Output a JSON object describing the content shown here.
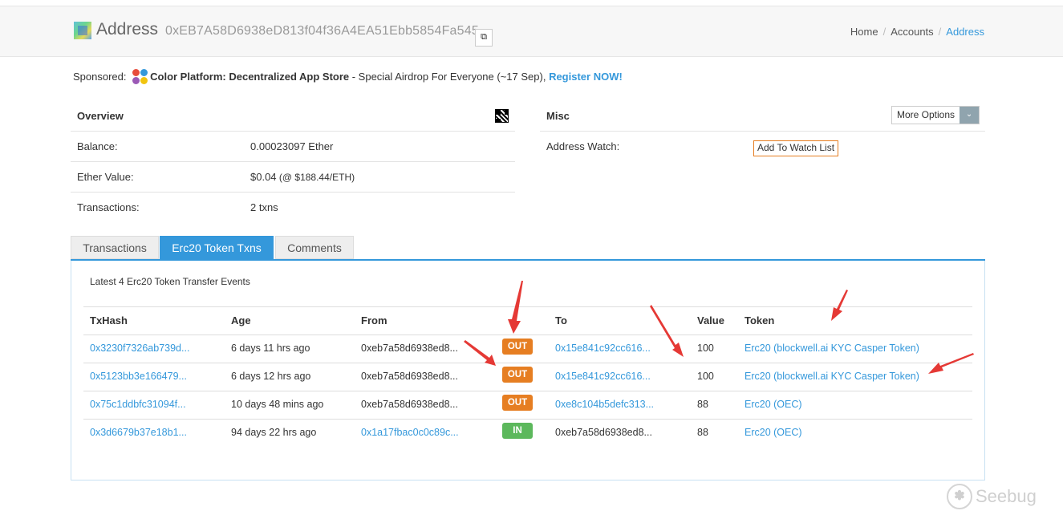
{
  "header": {
    "title": "Address",
    "address": "0xEB7A58D6938eD813f04f36A4EA51Ebb5854Fa545",
    "breadcrumb": [
      "Home",
      "Accounts",
      "Address"
    ]
  },
  "sponsored": {
    "label": "Sponsored:",
    "name": "Color Platform: Decentralized App Store",
    "text": " - Special Airdrop For Everyone (~17 Sep), ",
    "cta": "Register NOW!"
  },
  "overview": {
    "title": "Overview",
    "rows": [
      {
        "label": "Balance:",
        "value": "0.00023097 Ether"
      },
      {
        "label": "Ether Value:",
        "value": "$0.04",
        "extra": " (@ $188.44/ETH)"
      },
      {
        "label": "Transactions:",
        "value": "2 txns"
      }
    ]
  },
  "misc": {
    "title": "Misc",
    "more_options": "More Options",
    "watch_label": "Address Watch:",
    "watch_button": "Add To Watch List"
  },
  "tabs": [
    "Transactions",
    "Erc20 Token Txns",
    "Comments"
  ],
  "active_tab": 1,
  "token_txns": {
    "caption": "Latest 4 Erc20 Token Transfer Events",
    "columns": [
      "TxHash",
      "Age",
      "From",
      "",
      "To",
      "Value",
      "Token"
    ],
    "rows": [
      {
        "hash": "0x3230f7326ab739d...",
        "age": "6 days 11 hrs ago",
        "from": "0xeb7a58d6938ed8...",
        "dir": "OUT",
        "to": "0x15e841c92cc616...",
        "value": "100",
        "token": "Erc20 (blockwell.ai KYC Casper Token)"
      },
      {
        "hash": "0x5123bb3e166479...",
        "age": "6 days 12 hrs ago",
        "from": "0xeb7a58d6938ed8...",
        "dir": "OUT",
        "to": "0x15e841c92cc616...",
        "value": "100",
        "token": "Erc20 (blockwell.ai KYC Casper Token)"
      },
      {
        "hash": "0x75c1ddbfc31094f...",
        "age": "10 days 48 mins ago",
        "from": "0xeb7a58d6938ed8...",
        "dir": "OUT",
        "to": "0xe8c104b5defc313...",
        "value": "88",
        "token": "Erc20 (OEC)"
      },
      {
        "hash": "0x3d6679b37e18b1...",
        "age": "94 days 22 hrs ago",
        "from": "0x1a17fbac0c0c89c...",
        "dir": "IN",
        "to": "0xeb7a58d6938ed8...",
        "value": "88",
        "token": "Erc20 (OEC)"
      }
    ]
  },
  "watermark": "Seebug",
  "colors": {
    "link": "#3498db",
    "out": "#e67e22",
    "in": "#5cb85c",
    "arrow": "#e53935"
  }
}
